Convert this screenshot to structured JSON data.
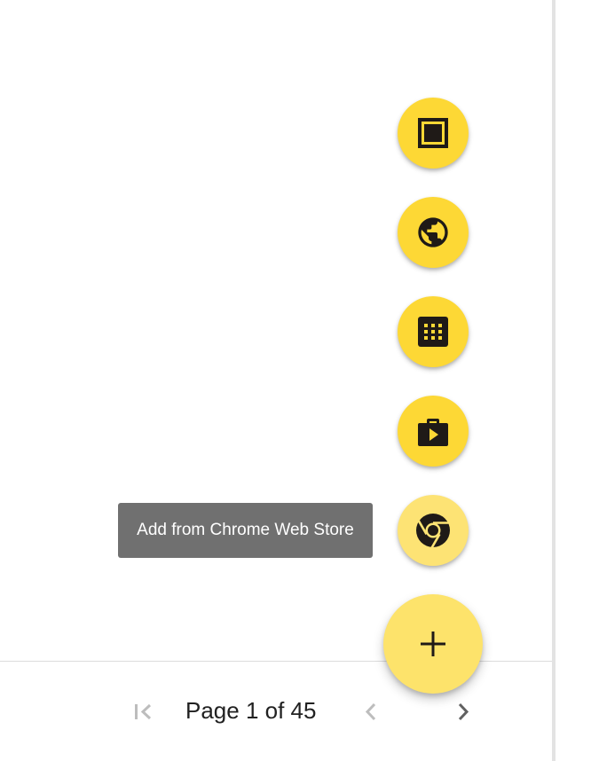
{
  "fab_menu": {
    "actions": [
      {
        "icon": "square-frame-icon"
      },
      {
        "icon": "globe-icon"
      },
      {
        "icon": "app-grid-icon"
      },
      {
        "icon": "play-store-bag-icon"
      },
      {
        "icon": "chrome-icon"
      }
    ],
    "main_icon": "plus-icon",
    "tooltip": "Add from Chrome Web Store"
  },
  "pagination": {
    "label": "Page 1 of 45",
    "first_icon": "first-page-icon",
    "prev_icon": "chevron-left-icon",
    "next_icon": "chevron-right-icon"
  },
  "colors": {
    "fab": "#fdd835",
    "fab_faded": "#fde374",
    "icon": "#1f1a17",
    "tooltip_bg": "#707070",
    "disabled": "#bdbdbd",
    "enabled": "#616161"
  }
}
